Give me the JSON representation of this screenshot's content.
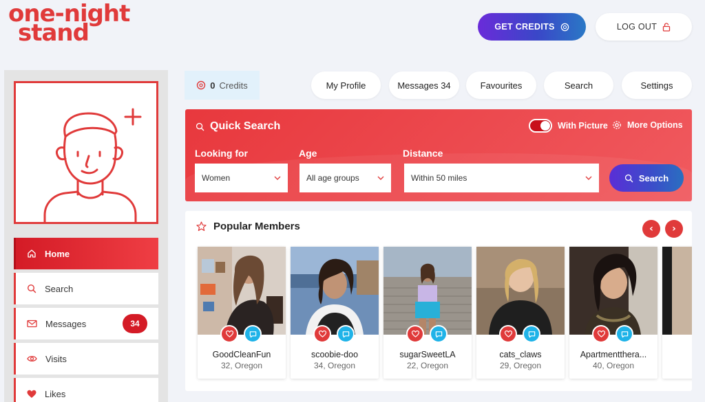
{
  "logo": {
    "line1": "one-night",
    "line2": "stand"
  },
  "header": {
    "get_credits": "GET CREDITS",
    "log_out": "LOG OUT"
  },
  "sidebar": {
    "items": [
      {
        "label": "Home",
        "icon": "home-icon"
      },
      {
        "label": "Search",
        "icon": "search-icon"
      },
      {
        "label": "Messages",
        "icon": "mail-icon",
        "badge": "34"
      },
      {
        "label": "Visits",
        "icon": "eye-icon"
      },
      {
        "label": "Likes",
        "icon": "heart-icon"
      }
    ]
  },
  "credits": {
    "count": "0",
    "label": "Credits"
  },
  "tabs": [
    "My Profile",
    "Messages 34",
    "Favourites",
    "Search",
    "Settings"
  ],
  "quick_search": {
    "title": "Quick Search",
    "with_picture": "With Picture",
    "with_picture_on": true,
    "more_options": "More Options",
    "looking_for_label": "Looking for",
    "looking_for_value": "Women",
    "age_label": "Age",
    "age_value": "All age groups",
    "distance_label": "Distance",
    "distance_value": "Within 50 miles",
    "search_button": "Search"
  },
  "popular": {
    "title": "Popular Members",
    "members": [
      {
        "name": "GoodCleanFun",
        "info": "32, Oregon"
      },
      {
        "name": "scoobie-doo",
        "info": "34, Oregon"
      },
      {
        "name": "sugarSweetLA",
        "info": "22, Oregon"
      },
      {
        "name": "cats_claws",
        "info": "29, Oregon"
      },
      {
        "name": "Apartmentthera...",
        "info": "40, Oregon"
      }
    ]
  },
  "colors": {
    "brand_red": "#e03a3a",
    "accent_purple": "#5a2ed6",
    "chat_blue": "#1fb3e8"
  }
}
